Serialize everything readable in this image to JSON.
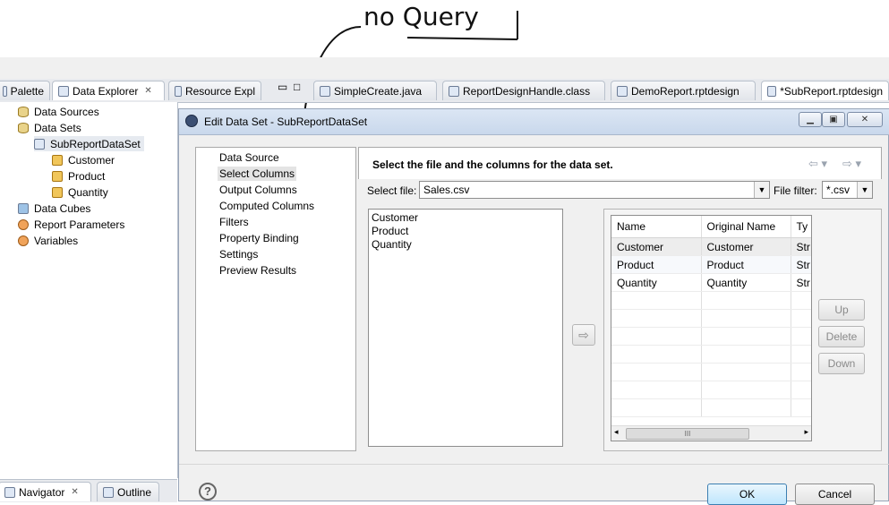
{
  "annotation": {
    "text": "no Query"
  },
  "editor_tabs": [
    {
      "label": "Palette",
      "icon": "palette-icon"
    },
    {
      "label": "Data Explorer",
      "icon": "data-explorer-icon"
    },
    {
      "label": "Resource Expl",
      "icon": "resource-explorer-icon"
    },
    {
      "label": "SimpleCreate.java",
      "icon": "java-file-icon"
    },
    {
      "label": "ReportDesignHandle.class",
      "icon": "class-file-icon"
    },
    {
      "label": "DemoReport.rptdesign",
      "icon": "report-file-icon"
    },
    {
      "label": "*SubReport.rptdesign",
      "icon": "report-file-icon"
    }
  ],
  "data_explorer": {
    "items": [
      {
        "label": "Data Sources",
        "icon": "data-sources-icon"
      },
      {
        "label": "Data Sets",
        "icon": "data-sets-icon"
      },
      {
        "label": "SubReportDataSet",
        "icon": "data-set-icon"
      },
      {
        "label": "Customer",
        "icon": "column-icon"
      },
      {
        "label": "Product",
        "icon": "column-icon"
      },
      {
        "label": "Quantity",
        "icon": "column-icon"
      },
      {
        "label": "Data Cubes",
        "icon": "data-cubes-icon"
      },
      {
        "label": "Report Parameters",
        "icon": "report-parameters-icon"
      },
      {
        "label": "Variables",
        "icon": "variables-icon"
      }
    ]
  },
  "bottom_tabs": [
    {
      "label": "Navigator",
      "icon": "navigator-icon"
    },
    {
      "label": "Outline",
      "icon": "outline-icon"
    }
  ],
  "dialog": {
    "title": "Edit Data Set - SubReportDataSet",
    "nav_items": [
      "Data Source",
      "Select Columns",
      "Output Columns",
      "Computed Columns",
      "Filters",
      "Property Binding",
      "Settings",
      "Preview Results"
    ],
    "selected_nav": "Select Columns",
    "heading": "Select the file and the columns for the data set.",
    "select_file_label": "Select file:",
    "select_file_value": "Sales.csv",
    "file_filter_label": "File filter:",
    "file_filter_value": "*.csv",
    "available_columns": [
      "Customer",
      "Product",
      "Quantity"
    ],
    "table": {
      "headers": [
        "Name",
        "Original Name",
        "Ty"
      ],
      "rows": [
        [
          "Customer",
          "Customer",
          "Str"
        ],
        [
          "Product",
          "Product",
          "Str"
        ],
        [
          "Quantity",
          "Quantity",
          "Str"
        ]
      ]
    },
    "buttons": {
      "up": "Up",
      "delete": "Delete",
      "down": "Down",
      "ok": "OK",
      "cancel": "Cancel"
    },
    "scroll_thumb_label": "III"
  }
}
